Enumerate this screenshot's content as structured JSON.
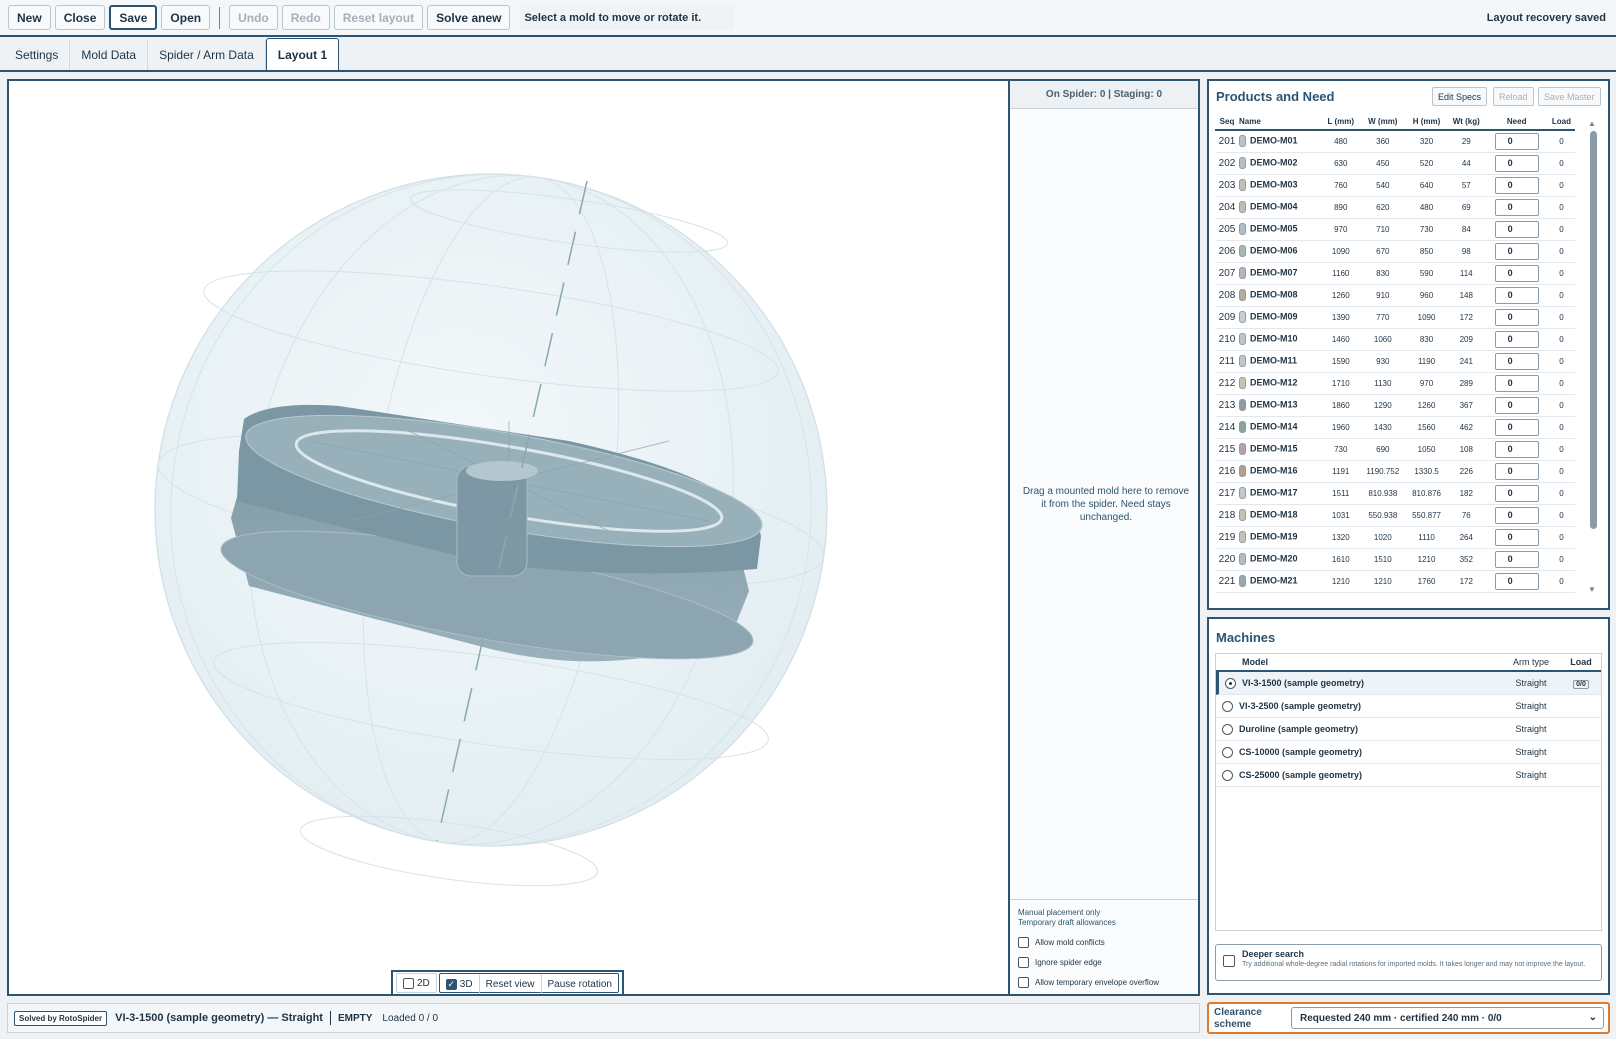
{
  "toolbar": {
    "new": "New",
    "close": "Close",
    "save": "Save",
    "open": "Open",
    "undo": "Undo",
    "redo": "Redo",
    "reset_layout": "Reset layout",
    "solve_anew": "Solve anew",
    "status": "Select a mold to move or rotate it.",
    "recovery": "Layout recovery saved"
  },
  "tabs": [
    "Settings",
    "Mold Data",
    "Spider / Arm Data",
    "Layout 1"
  ],
  "staging": {
    "header": "On Spider: 0 | Staging: 0",
    "hint": "Drag a mounted mold here to remove it from the spider. Need stays unchanged.",
    "note1": "Manual placement only",
    "note2": "Temporary draft allowances",
    "opt1": "Allow mold conflicts",
    "opt2": "Ignore spider edge",
    "opt3": "Allow temporary envelope overflow"
  },
  "view_controls": {
    "v2d": "2D",
    "v3d": "3D",
    "reset_view": "Reset view",
    "pause": "Pause rotation"
  },
  "statusbar": {
    "badge": "Solved by RotoSpider",
    "machine": "VI-3-1500 (sample geometry) — Straight",
    "state": "EMPTY",
    "loaded": "Loaded 0 / 0"
  },
  "products": {
    "title": "Products and Need",
    "edit_specs": "Edit Specs",
    "reload": "Reload",
    "save_master": "Save Master",
    "columns": [
      "Seq",
      "Name",
      "L (mm)",
      "W (mm)",
      "H (mm)",
      "Wt (kg)",
      "Need",
      "Load"
    ],
    "rows": [
      {
        "seq": "201",
        "name": "DEMO-M01",
        "l": "480",
        "w": "360",
        "h": "320",
        "wt": "29",
        "need": "0",
        "load": "0",
        "color": "#b9c3c9"
      },
      {
        "seq": "202",
        "name": "DEMO-M02",
        "l": "630",
        "w": "450",
        "h": "520",
        "wt": "44",
        "need": "0",
        "load": "0",
        "color": "#b3c2bd"
      },
      {
        "seq": "203",
        "name": "DEMO-M03",
        "l": "760",
        "w": "540",
        "h": "640",
        "wt": "57",
        "need": "0",
        "load": "0",
        "color": "#c3c0b4"
      },
      {
        "seq": "204",
        "name": "DEMO-M04",
        "l": "890",
        "w": "620",
        "h": "480",
        "wt": "69",
        "need": "0",
        "load": "0",
        "color": "#bdbfb0"
      },
      {
        "seq": "205",
        "name": "DEMO-M05",
        "l": "970",
        "w": "710",
        "h": "730",
        "wt": "84",
        "need": "0",
        "load": "0",
        "color": "#b0bec8"
      },
      {
        "seq": "206",
        "name": "DEMO-M06",
        "l": "1090",
        "w": "670",
        "h": "850",
        "wt": "98",
        "need": "0",
        "load": "0",
        "color": "#a6b9b0"
      },
      {
        "seq": "207",
        "name": "DEMO-M07",
        "l": "1160",
        "w": "830",
        "h": "590",
        "wt": "114",
        "need": "0",
        "load": "0",
        "color": "#b8b4bf"
      },
      {
        "seq": "208",
        "name": "DEMO-M08",
        "l": "1260",
        "w": "910",
        "h": "960",
        "wt": "148",
        "need": "0",
        "load": "0",
        "color": "#b5ab9c"
      },
      {
        "seq": "209",
        "name": "DEMO-M09",
        "l": "1390",
        "w": "770",
        "h": "1090",
        "wt": "172",
        "need": "0",
        "load": "0",
        "color": "#c6ced3"
      },
      {
        "seq": "210",
        "name": "DEMO-M10",
        "l": "1460",
        "w": "1060",
        "h": "830",
        "wt": "209",
        "need": "0",
        "load": "0",
        "color": "#bfc6c9"
      },
      {
        "seq": "211",
        "name": "DEMO-M11",
        "l": "1590",
        "w": "930",
        "h": "1190",
        "wt": "241",
        "need": "0",
        "load": "0",
        "color": "#c2c7cc"
      },
      {
        "seq": "212",
        "name": "DEMO-M12",
        "l": "1710",
        "w": "1130",
        "h": "970",
        "wt": "289",
        "need": "0",
        "load": "0",
        "color": "#c9c3b0"
      },
      {
        "seq": "213",
        "name": "DEMO-M13",
        "l": "1860",
        "w": "1290",
        "h": "1260",
        "wt": "367",
        "need": "0",
        "load": "0",
        "color": "#8e9aa6"
      },
      {
        "seq": "214",
        "name": "DEMO-M14",
        "l": "1960",
        "w": "1430",
        "h": "1560",
        "wt": "462",
        "need": "0",
        "load": "0",
        "color": "#8aa69a"
      },
      {
        "seq": "215",
        "name": "DEMO-M15",
        "l": "730",
        "w": "690",
        "h": "1050",
        "wt": "108",
        "need": "0",
        "load": "0",
        "color": "#b79fb0"
      },
      {
        "seq": "216",
        "name": "DEMO-M16",
        "l": "1191",
        "w": "1190.752",
        "h": "1330.5",
        "wt": "226",
        "need": "0",
        "load": "0",
        "color": "#b0a08c"
      },
      {
        "seq": "217",
        "name": "DEMO-M17",
        "l": "1511",
        "w": "810.938",
        "h": "810.876",
        "wt": "182",
        "need": "0",
        "load": "0",
        "color": "#c6c9c9"
      },
      {
        "seq": "218",
        "name": "DEMO-M18",
        "l": "1031",
        "w": "550.938",
        "h": "550.877",
        "wt": "76",
        "need": "0",
        "load": "0",
        "color": "#c8c2b4"
      },
      {
        "seq": "219",
        "name": "DEMO-M19",
        "l": "1320",
        "w": "1020",
        "h": "1110",
        "wt": "264",
        "need": "0",
        "load": "0",
        "color": "#c9bfb2"
      },
      {
        "seq": "220",
        "name": "DEMO-M20",
        "l": "1610",
        "w": "1510",
        "h": "1210",
        "wt": "352",
        "need": "0",
        "load": "0",
        "color": "#b6bcc0"
      },
      {
        "seq": "221",
        "name": "DEMO-M21",
        "l": "1210",
        "w": "1210",
        "h": "1760",
        "wt": "172",
        "need": "0",
        "load": "0",
        "color": "#9aa8b2"
      }
    ]
  },
  "machines": {
    "title": "Machines",
    "columns": [
      "Model",
      "Arm type",
      "Load"
    ],
    "rows": [
      {
        "model": "VI-3-1500 (sample geometry)",
        "arm": "Straight",
        "load": "0/0",
        "selected": true
      },
      {
        "model": "VI-3-2500 (sample geometry)",
        "arm": "Straight",
        "load": "",
        "selected": false
      },
      {
        "model": "Duroline (sample geometry)",
        "arm": "Straight",
        "load": "",
        "selected": false
      },
      {
        "model": "CS-10000 (sample geometry)",
        "arm": "Straight",
        "load": "",
        "selected": false
      },
      {
        "model": "CS-25000 (sample geometry)",
        "arm": "Straight",
        "load": "",
        "selected": false
      }
    ],
    "deeper_title": "Deeper search",
    "deeper_desc": "Try additional whole-degree radial rotations for imported molds. It takes longer and may not improve the layout."
  },
  "clearance": {
    "label": "Clearance scheme",
    "value": "Requested 240 mm · certified 240 mm · 0/0"
  },
  "colors": {
    "accent": "#2d5470",
    "mold": "#8fa8b3",
    "highlight": "#e07a2a"
  }
}
